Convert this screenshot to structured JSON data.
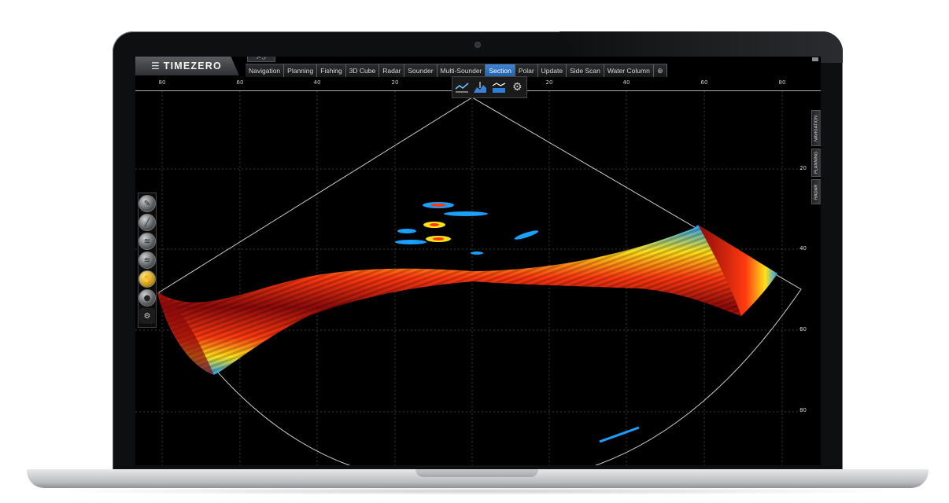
{
  "app": {
    "brand": "TIMEZERO",
    "menu_icon": "hamburger-menu-icon"
  },
  "tabs": [
    {
      "label": "Navigation",
      "active": false
    },
    {
      "label": "Planning",
      "active": false
    },
    {
      "label": "Fishing",
      "active": false
    },
    {
      "label": "3D Cube",
      "active": false
    },
    {
      "label": "Radar",
      "active": false
    },
    {
      "label": "Sounder",
      "active": false
    },
    {
      "label": "Multi-Sounder",
      "active": false
    },
    {
      "label": "Section",
      "active": true
    },
    {
      "label": "Polar",
      "active": false
    },
    {
      "label": "Update",
      "active": false
    },
    {
      "label": "Side Scan",
      "active": false
    },
    {
      "label": "Water Column",
      "active": false
    }
  ],
  "add_tab_icon": "plus-circle-icon",
  "top_scale": [
    "80",
    "60",
    "40",
    "20",
    "20",
    "40",
    "60",
    "80"
  ],
  "depth_scale": [
    "20",
    "40",
    "60",
    "80"
  ],
  "side_tabs": [
    "NAVIGATION",
    "PLANNING",
    "RADAR"
  ],
  "section_toolbar": [
    "section-profile-icon",
    "section-bottom-icon",
    "section-grid-icon",
    "settings-gear-icon"
  ],
  "left_tools": [
    "probe-icon",
    "pen-icon",
    "layer-icon",
    "layer-dim-icon",
    "hand-icon",
    "circle-icon",
    "gear-icon"
  ],
  "colors": {
    "active_tab": "#2f73c2",
    "echo_strong": "#8b0a0a",
    "echo_mid": "#ff3a10",
    "echo_warm": "#ffd21a",
    "echo_weak": "#18a8ff"
  }
}
